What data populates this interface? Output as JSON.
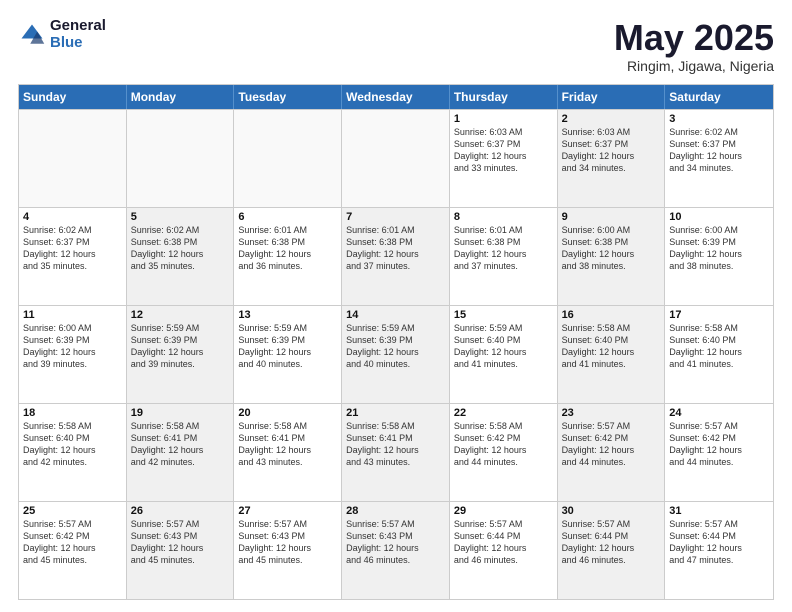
{
  "logo": {
    "general": "General",
    "blue": "Blue"
  },
  "title": "May 2025",
  "subtitle": "Ringim, Jigawa, Nigeria",
  "days": [
    "Sunday",
    "Monday",
    "Tuesday",
    "Wednesday",
    "Thursday",
    "Friday",
    "Saturday"
  ],
  "rows": [
    [
      {
        "num": "",
        "empty": true
      },
      {
        "num": "",
        "empty": true
      },
      {
        "num": "",
        "empty": true
      },
      {
        "num": "",
        "empty": true
      },
      {
        "num": "1",
        "info": "Sunrise: 6:03 AM\nSunset: 6:37 PM\nDaylight: 12 hours\nand 33 minutes."
      },
      {
        "num": "2",
        "info": "Sunrise: 6:03 AM\nSunset: 6:37 PM\nDaylight: 12 hours\nand 34 minutes.",
        "shaded": true
      },
      {
        "num": "3",
        "info": "Sunrise: 6:02 AM\nSunset: 6:37 PM\nDaylight: 12 hours\nand 34 minutes."
      }
    ],
    [
      {
        "num": "4",
        "info": "Sunrise: 6:02 AM\nSunset: 6:37 PM\nDaylight: 12 hours\nand 35 minutes."
      },
      {
        "num": "5",
        "info": "Sunrise: 6:02 AM\nSunset: 6:38 PM\nDaylight: 12 hours\nand 35 minutes.",
        "shaded": true
      },
      {
        "num": "6",
        "info": "Sunrise: 6:01 AM\nSunset: 6:38 PM\nDaylight: 12 hours\nand 36 minutes."
      },
      {
        "num": "7",
        "info": "Sunrise: 6:01 AM\nSunset: 6:38 PM\nDaylight: 12 hours\nand 37 minutes.",
        "shaded": true
      },
      {
        "num": "8",
        "info": "Sunrise: 6:01 AM\nSunset: 6:38 PM\nDaylight: 12 hours\nand 37 minutes."
      },
      {
        "num": "9",
        "info": "Sunrise: 6:00 AM\nSunset: 6:38 PM\nDaylight: 12 hours\nand 38 minutes.",
        "shaded": true
      },
      {
        "num": "10",
        "info": "Sunrise: 6:00 AM\nSunset: 6:39 PM\nDaylight: 12 hours\nand 38 minutes."
      }
    ],
    [
      {
        "num": "11",
        "info": "Sunrise: 6:00 AM\nSunset: 6:39 PM\nDaylight: 12 hours\nand 39 minutes."
      },
      {
        "num": "12",
        "info": "Sunrise: 5:59 AM\nSunset: 6:39 PM\nDaylight: 12 hours\nand 39 minutes.",
        "shaded": true
      },
      {
        "num": "13",
        "info": "Sunrise: 5:59 AM\nSunset: 6:39 PM\nDaylight: 12 hours\nand 40 minutes."
      },
      {
        "num": "14",
        "info": "Sunrise: 5:59 AM\nSunset: 6:39 PM\nDaylight: 12 hours\nand 40 minutes.",
        "shaded": true
      },
      {
        "num": "15",
        "info": "Sunrise: 5:59 AM\nSunset: 6:40 PM\nDaylight: 12 hours\nand 41 minutes."
      },
      {
        "num": "16",
        "info": "Sunrise: 5:58 AM\nSunset: 6:40 PM\nDaylight: 12 hours\nand 41 minutes.",
        "shaded": true
      },
      {
        "num": "17",
        "info": "Sunrise: 5:58 AM\nSunset: 6:40 PM\nDaylight: 12 hours\nand 41 minutes."
      }
    ],
    [
      {
        "num": "18",
        "info": "Sunrise: 5:58 AM\nSunset: 6:40 PM\nDaylight: 12 hours\nand 42 minutes."
      },
      {
        "num": "19",
        "info": "Sunrise: 5:58 AM\nSunset: 6:41 PM\nDaylight: 12 hours\nand 42 minutes.",
        "shaded": true
      },
      {
        "num": "20",
        "info": "Sunrise: 5:58 AM\nSunset: 6:41 PM\nDaylight: 12 hours\nand 43 minutes."
      },
      {
        "num": "21",
        "info": "Sunrise: 5:58 AM\nSunset: 6:41 PM\nDaylight: 12 hours\nand 43 minutes.",
        "shaded": true
      },
      {
        "num": "22",
        "info": "Sunrise: 5:58 AM\nSunset: 6:42 PM\nDaylight: 12 hours\nand 44 minutes."
      },
      {
        "num": "23",
        "info": "Sunrise: 5:57 AM\nSunset: 6:42 PM\nDaylight: 12 hours\nand 44 minutes.",
        "shaded": true
      },
      {
        "num": "24",
        "info": "Sunrise: 5:57 AM\nSunset: 6:42 PM\nDaylight: 12 hours\nand 44 minutes."
      }
    ],
    [
      {
        "num": "25",
        "info": "Sunrise: 5:57 AM\nSunset: 6:42 PM\nDaylight: 12 hours\nand 45 minutes."
      },
      {
        "num": "26",
        "info": "Sunrise: 5:57 AM\nSunset: 6:43 PM\nDaylight: 12 hours\nand 45 minutes.",
        "shaded": true
      },
      {
        "num": "27",
        "info": "Sunrise: 5:57 AM\nSunset: 6:43 PM\nDaylight: 12 hours\nand 45 minutes."
      },
      {
        "num": "28",
        "info": "Sunrise: 5:57 AM\nSunset: 6:43 PM\nDaylight: 12 hours\nand 46 minutes.",
        "shaded": true
      },
      {
        "num": "29",
        "info": "Sunrise: 5:57 AM\nSunset: 6:44 PM\nDaylight: 12 hours\nand 46 minutes."
      },
      {
        "num": "30",
        "info": "Sunrise: 5:57 AM\nSunset: 6:44 PM\nDaylight: 12 hours\nand 46 minutes.",
        "shaded": true
      },
      {
        "num": "31",
        "info": "Sunrise: 5:57 AM\nSunset: 6:44 PM\nDaylight: 12 hours\nand 47 minutes."
      }
    ]
  ]
}
